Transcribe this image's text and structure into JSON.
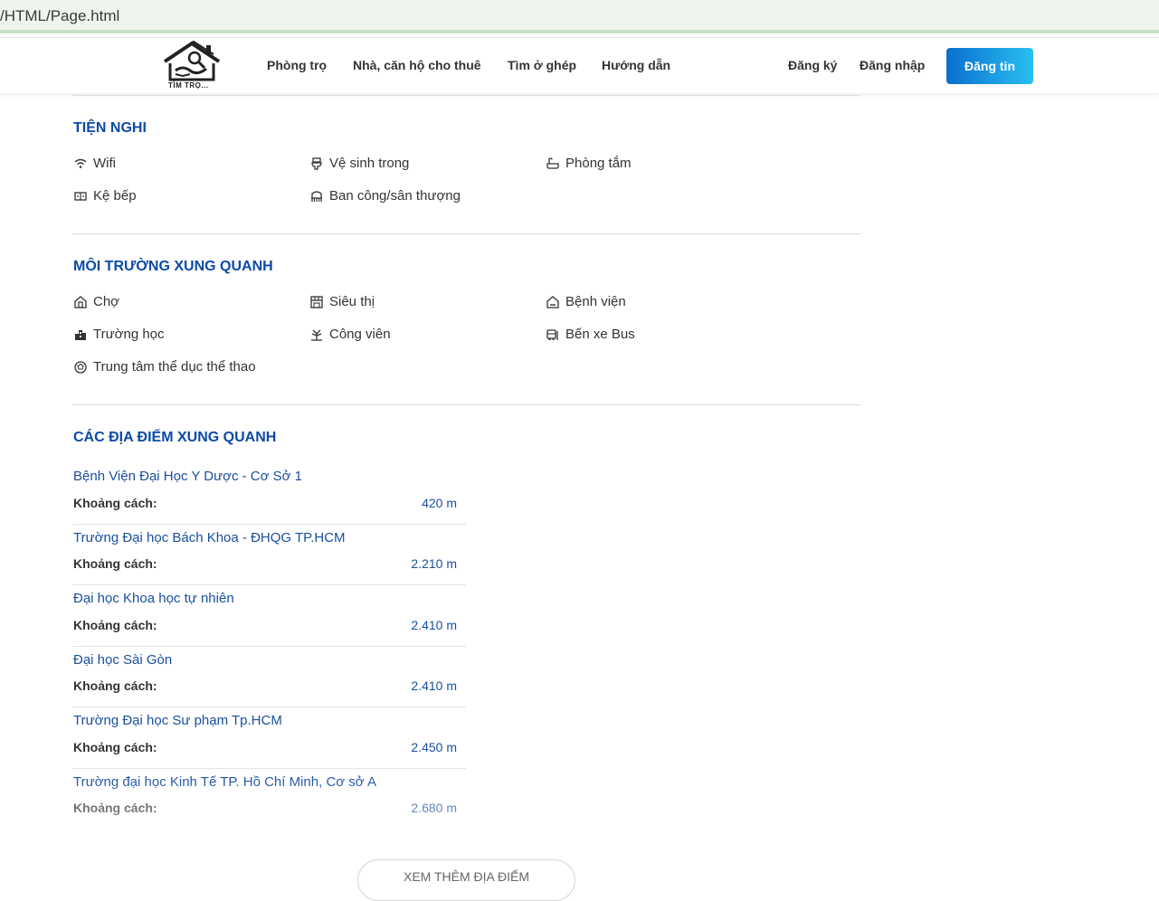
{
  "browser": {
    "url": "/HTML/Page.html"
  },
  "header": {
    "logo_text": "TÌM TRỌ...",
    "nav": [
      "Phòng trọ",
      "Nhà, căn hộ cho thuê",
      "Tìm ở ghép",
      "Hướng dẫn"
    ],
    "register": "Đăng ký",
    "login": "Đăng nhập",
    "post_button": "Đăng tin"
  },
  "amenities": {
    "title": "TIỆN NGHI",
    "items": [
      {
        "label": "Wifi",
        "icon": "wifi-icon"
      },
      {
        "label": "Vệ sinh trong",
        "icon": "toilet-icon"
      },
      {
        "label": "Phòng tắm",
        "icon": "bathtub-icon"
      },
      {
        "label": "Kệ bếp",
        "icon": "kitchen-icon"
      },
      {
        "label": "Ban công/sân thượng",
        "icon": "balcony-icon"
      }
    ]
  },
  "environment": {
    "title": "MÔI TRƯỜNG XUNG QUANH",
    "items": [
      {
        "label": "Chợ",
        "icon": "market-icon"
      },
      {
        "label": "Siêu thị",
        "icon": "supermarket-icon"
      },
      {
        "label": "Bệnh viện",
        "icon": "hospital-icon"
      },
      {
        "label": "Trường học",
        "icon": "school-icon"
      },
      {
        "label": "Công viên",
        "icon": "park-icon"
      },
      {
        "label": "Bến xe Bus",
        "icon": "bus-icon"
      },
      {
        "label": "Trung tâm thể dục thể thao",
        "icon": "sports-icon"
      }
    ]
  },
  "places": {
    "title": "CÁC ĐỊA ĐIỂM XUNG QUANH",
    "distance_label": "Khoảng cách:",
    "items": [
      {
        "name": "Bệnh Viện Đại Học Y Dược - Cơ Sở 1",
        "distance": "420 m"
      },
      {
        "name": "Trường Đại học Bách Khoa - ĐHQG TP.HCM",
        "distance": "2.210 m"
      },
      {
        "name": "Đại học Khoa học tự nhiên",
        "distance": "2.410 m"
      },
      {
        "name": "Đại học Sài Gòn",
        "distance": "2.410 m"
      },
      {
        "name": "Trường Đại học Sư phạm Tp.HCM",
        "distance": "2.450 m"
      },
      {
        "name": "Trường đại học Kinh Tế TP. Hồ Chí Minh, Cơ sở A",
        "distance": "2.680 m"
      }
    ],
    "more_button": "XEM THÊM ĐỊA ĐIỂM"
  },
  "colors": {
    "accent": "#0b4aa8",
    "link": "#1a4fa0",
    "button_start": "#0a6fd0",
    "button_end": "#28c0f0"
  }
}
